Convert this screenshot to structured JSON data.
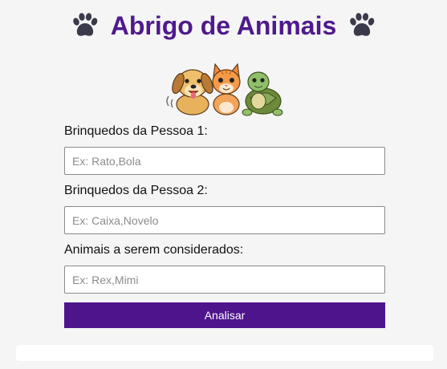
{
  "header": {
    "title": "Abrigo de Animais",
    "left_icon": "paw-icon",
    "right_icon": "paw-icon",
    "title_color": "#4e1a8c"
  },
  "hero": {
    "image": "dog-cat-turtle-illustration"
  },
  "form": {
    "field1": {
      "label": "Brinquedos da Pessoa 1:",
      "placeholder": "Ex: Rato,Bola",
      "value": ""
    },
    "field2": {
      "label": "Brinquedos da Pessoa 2:",
      "placeholder": "Ex: Caixa,Novelo",
      "value": ""
    },
    "field3": {
      "label": "Animais a serem considerados:",
      "placeholder": "Ex: Rex,Mimi",
      "value": ""
    },
    "submit_label": "Analisar",
    "accent_color": "#4e148c"
  },
  "result": {
    "text": ""
  }
}
